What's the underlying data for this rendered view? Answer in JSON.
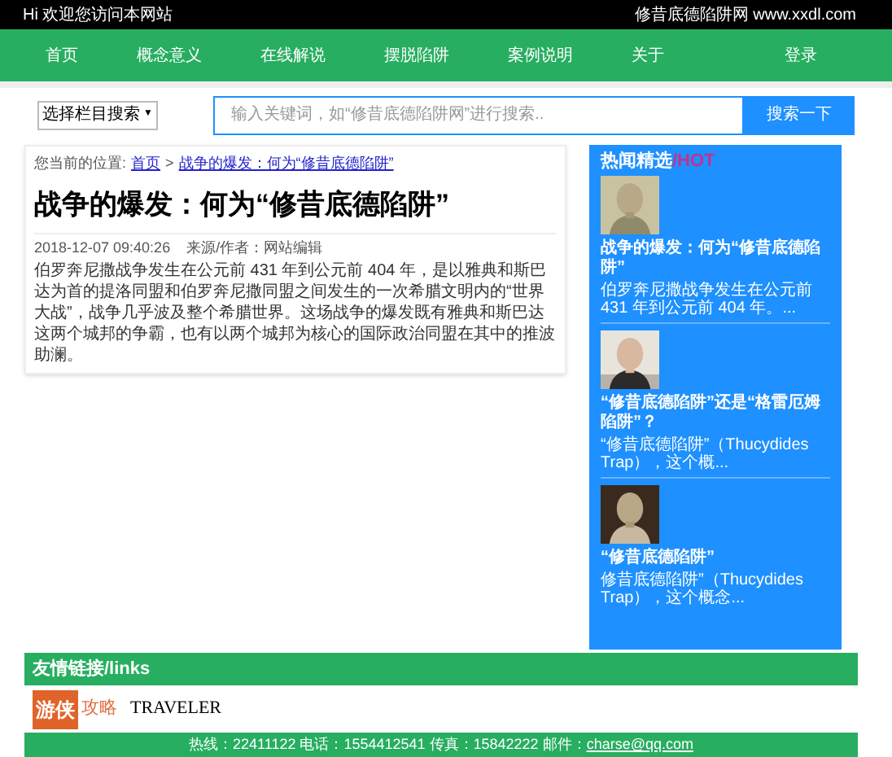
{
  "top_bar": {
    "greeting": "Hi 欢迎您访问本网站",
    "site": "修昔底德陷阱网 www.xxdl.com"
  },
  "nav": {
    "items": [
      {
        "label": "首页"
      },
      {
        "label": "概念意义"
      },
      {
        "label": "在线解说"
      },
      {
        "label": "摆脱陷阱"
      },
      {
        "label": "案例说明"
      },
      {
        "label": "关于"
      }
    ],
    "login": "登录"
  },
  "search": {
    "category": "选择栏目搜索",
    "caret": "▼",
    "placeholder": "输入关键词，如“修昔底德陷阱网”进行搜索..",
    "button": "搜索一下"
  },
  "breadcrumb": {
    "label": "您当前的位置:",
    "home": "首页",
    "separator": ">",
    "current": "战争的爆发：何为“修昔底德陷阱”"
  },
  "article": {
    "title": "战争的爆发：何为“修昔底德陷阱”",
    "date": "2018-12-07 09:40:26",
    "source": "来源/作者：网站编辑",
    "body": "伯罗奔尼撒战争发生在公元前 431 年到公元前 404 年，是以雅典和斯巴达为首的提洛同盟和伯罗奔尼撒同盟之间发生的一次希腊文明内的“世界大战”，战争几乎波及整个希腊世界。这场战争的爆发既有雅典和斯巴达这两个城邦的争霸，也有以两个城邦为核心的国际政治同盟在其中的推波助澜。"
  },
  "hot": {
    "title": "热闻精选",
    "title_en": "/HOT",
    "items": [
      {
        "title": "战争的爆发：何为“修昔底德陷阱”",
        "summary": "伯罗奔尼撒战争发生在公元前 431 年到公元前 404 年。..."
      },
      {
        "title": "“修昔底德陷阱”还是“格雷厄姆陷阱”？",
        "summary": "“修昔底德陷阱”（Thucydides Trap），这个概..."
      },
      {
        "title": "“修昔底德陷阱”",
        "summary": "修昔底德陷阱”（Thucydides Trap），这个概念..."
      }
    ]
  },
  "links": {
    "title": "友情链接/links",
    "logos": [
      {
        "kind": "youxia",
        "main": "游侠",
        "side": "攻略"
      },
      {
        "kind": "traveler",
        "main": "TRAVELER"
      }
    ]
  },
  "footer": {
    "contact": "热线：22411122 电话：1554412541 传真：15842222 邮件：",
    "email": "charse@qq.com"
  }
}
